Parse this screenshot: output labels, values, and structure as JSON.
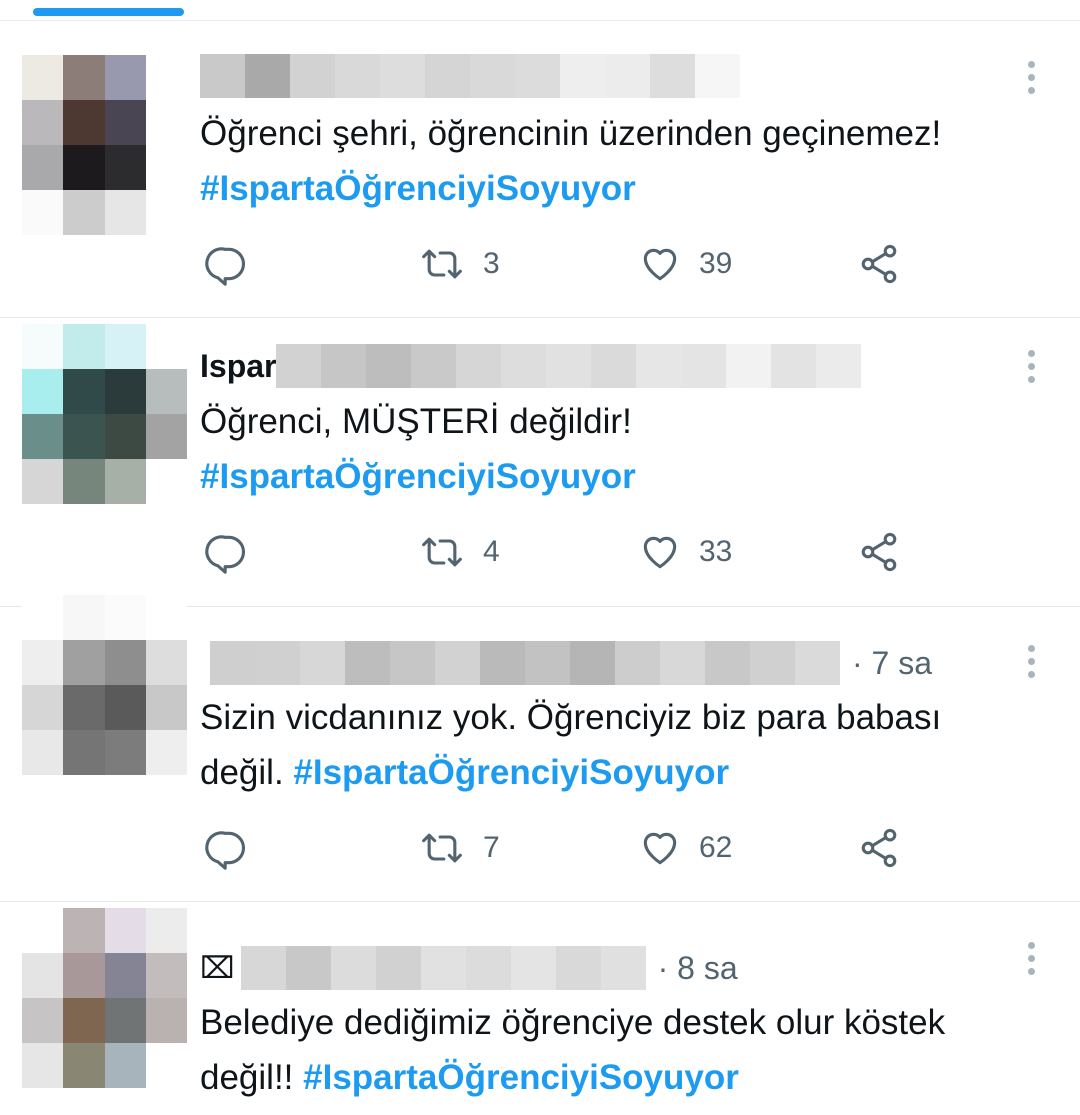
{
  "tweets": [
    {
      "name": "",
      "time": "",
      "text": "Öğrenci şehri, öğrencinin üzerinden geçinemez!",
      "hashtag": "#IspartaÖğrenciyiSoyuyor",
      "retweets": "3",
      "likes": "39"
    },
    {
      "name": "Ispar",
      "time": "",
      "text": "Öğrenci, MÜŞTERİ değildir!",
      "hashtag": "#IspartaÖğrenciyiSoyuyor",
      "retweets": "4",
      "likes": "33"
    },
    {
      "name": "",
      "time": "· 7 sa",
      "text": "Sizin vicdanınız yok. Öğrenciyiz biz para babası değil.",
      "hashtag": "#IspartaÖğrenciyiSoyuyor",
      "retweets": "7",
      "likes": "62"
    },
    {
      "name": "",
      "glyph": "⌧",
      "time": "· 8 sa",
      "text": "Belediye dediğimiz öğrenciye destek olur köstek değil!!",
      "hashtag": "#IspartaÖğrenciyiSoyuyor"
    }
  ],
  "icons": {
    "reply": "reply-icon",
    "retweet": "retweet-icon",
    "like": "heart-icon",
    "share": "share-icon",
    "more": "more-vertical-icon"
  },
  "colors": {
    "accent": "#1d9bf0",
    "secondary_text": "#536471",
    "divider": "#e1e8ed"
  }
}
